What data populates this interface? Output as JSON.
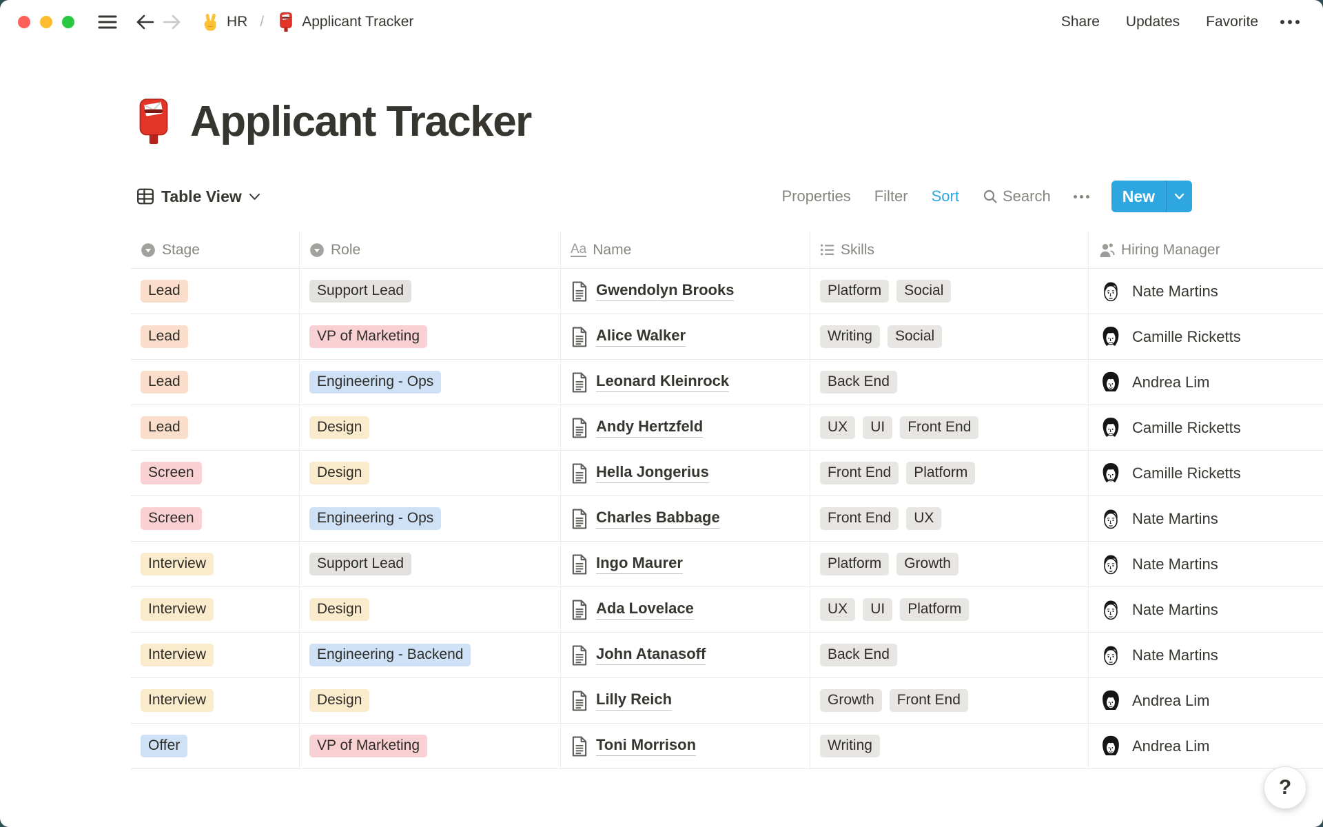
{
  "topbar": {
    "breadcrumb": {
      "workspace_icon": "victory-hand-emoji",
      "workspace": "HR",
      "separator": "/",
      "page_icon": "postbox-emoji",
      "page": "Applicant Tracker"
    },
    "actions": [
      "Share",
      "Updates",
      "Favorite"
    ]
  },
  "title": {
    "icon": "postbox-emoji",
    "text": "Applicant Tracker"
  },
  "toolbar": {
    "view_label": "Table View",
    "properties_label": "Properties",
    "filter_label": "Filter",
    "sort_label": "Sort",
    "search_label": "Search",
    "new_label": "New"
  },
  "table": {
    "columns": [
      {
        "id": "stage",
        "label": "Stage",
        "icon": "select"
      },
      {
        "id": "role",
        "label": "Role",
        "icon": "select"
      },
      {
        "id": "name",
        "label": "Name",
        "icon": "text",
        "icon_text": "Aa"
      },
      {
        "id": "skills",
        "label": "Skills",
        "icon": "list"
      },
      {
        "id": "manager",
        "label": "Hiring Manager",
        "icon": "person"
      }
    ],
    "rows": [
      {
        "stage": "Lead",
        "stage_color": "orange",
        "role": "Support Lead",
        "role_color": "gray",
        "name": "Gwendolyn Brooks",
        "skills": [
          "Platform",
          "Social"
        ],
        "manager": "Nate Martins",
        "avatar": "nate"
      },
      {
        "stage": "Lead",
        "stage_color": "orange",
        "role": "VP of Marketing",
        "role_color": "red",
        "name": "Alice Walker",
        "skills": [
          "Writing",
          "Social"
        ],
        "manager": "Camille Ricketts",
        "avatar": "camille"
      },
      {
        "stage": "Lead",
        "stage_color": "orange",
        "role": "Engineering - Ops",
        "role_color": "blue",
        "name": "Leonard Kleinrock",
        "skills": [
          "Back End"
        ],
        "manager": "Andrea Lim",
        "avatar": "andrea"
      },
      {
        "stage": "Lead",
        "stage_color": "orange",
        "role": "Design",
        "role_color": "yellow",
        "name": "Andy Hertzfeld",
        "skills": [
          "UX",
          "UI",
          "Front End"
        ],
        "manager": "Camille Ricketts",
        "avatar": "camille"
      },
      {
        "stage": "Screen",
        "stage_color": "red",
        "role": "Design",
        "role_color": "yellow",
        "name": "Hella Jongerius",
        "skills": [
          "Front End",
          "Platform"
        ],
        "manager": "Camille Ricketts",
        "avatar": "camille"
      },
      {
        "stage": "Screen",
        "stage_color": "red",
        "role": "Engineering - Ops",
        "role_color": "blue",
        "name": "Charles Babbage",
        "skills": [
          "Front End",
          "UX"
        ],
        "manager": "Nate Martins",
        "avatar": "nate"
      },
      {
        "stage": "Interview",
        "stage_color": "yellow",
        "role": "Support Lead",
        "role_color": "gray",
        "name": "Ingo Maurer",
        "skills": [
          "Platform",
          "Growth"
        ],
        "manager": "Nate Martins",
        "avatar": "nate"
      },
      {
        "stage": "Interview",
        "stage_color": "yellow",
        "role": "Design",
        "role_color": "yellow",
        "name": "Ada Lovelace",
        "skills": [
          "UX",
          "UI",
          "Platform"
        ],
        "manager": "Nate Martins",
        "avatar": "nate"
      },
      {
        "stage": "Interview",
        "stage_color": "yellow",
        "role": "Engineering - Backend",
        "role_color": "blue",
        "name": "John Atanasoff",
        "skills": [
          "Back End"
        ],
        "manager": "Nate Martins",
        "avatar": "nate"
      },
      {
        "stage": "Interview",
        "stage_color": "yellow",
        "role": "Design",
        "role_color": "yellow",
        "name": "Lilly Reich",
        "skills": [
          "Growth",
          "Front End"
        ],
        "manager": "Andrea Lim",
        "avatar": "andrea"
      },
      {
        "stage": "Offer",
        "stage_color": "blue",
        "role": "VP of Marketing",
        "role_color": "red",
        "name": "Toni Morrison",
        "skills": [
          "Writing"
        ],
        "manager": "Andrea Lim",
        "avatar": "andrea"
      }
    ]
  },
  "colors": {
    "accent_blue": "#2ea7e0",
    "tags": {
      "orange": "#faddcb",
      "red": "#f9d0d3",
      "yellow": "#faebcd",
      "blue": "#cee1f6",
      "gray": "#e3e2df",
      "skill": "#e7e6e3"
    },
    "traffic": [
      "#fe5f57",
      "#febc2e",
      "#28c840"
    ]
  },
  "help": {
    "label": "?"
  }
}
